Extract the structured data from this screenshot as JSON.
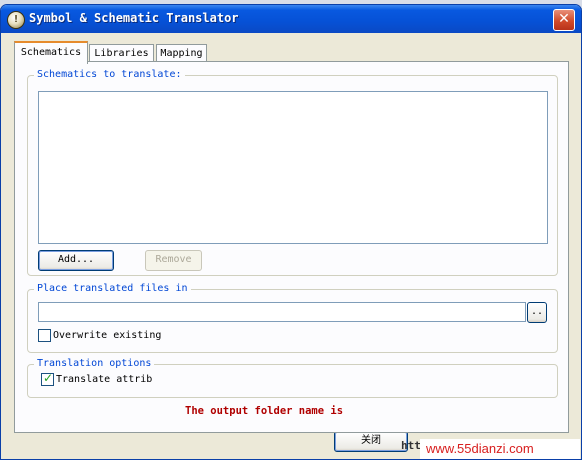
{
  "window": {
    "title": "Symbol & Schematic Translator",
    "close_glyph": "✕",
    "app_icon_glyph": "!"
  },
  "tabs": [
    {
      "label": "Schematics",
      "active": true
    },
    {
      "label": "Libraries",
      "active": false
    },
    {
      "label": "Mapping",
      "active": false
    }
  ],
  "schematics_group": {
    "legend": "Schematics to translate:",
    "items": [],
    "add_label": "Add...",
    "remove_label": "Remove"
  },
  "place_group": {
    "legend": "Place translated files in",
    "path_value": "",
    "browse_label": "..",
    "overwrite_label": "Overwrite existing",
    "overwrite_checked": false
  },
  "options_group": {
    "legend": "Translation options",
    "translate_label": "Translate attrib",
    "translate_checked": true
  },
  "status_message": "The output folder name is",
  "footer": {
    "close_label": "关闭",
    "partial_text": "http"
  },
  "watermark": "www.55dianzi.com",
  "colors": {
    "title_bar": "#0651d6",
    "legend_text": "#0046d5",
    "message_text": "#b00000",
    "watermark_text": "#d81e1e"
  }
}
